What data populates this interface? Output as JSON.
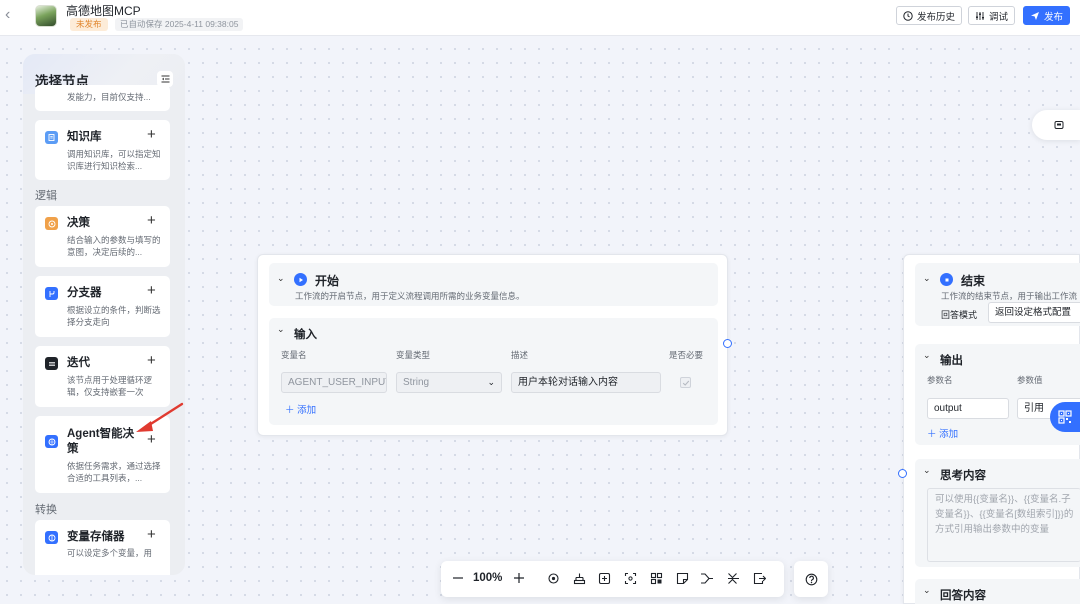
{
  "header": {
    "app_title": "高德地图MCP",
    "status_badge": "未发布",
    "autosave": "已自动保存 2025-4-11 09:38:05",
    "history_label": "发布历史",
    "debug_label": "调试",
    "publish_label": "发布"
  },
  "sidebar": {
    "title": "选择节点",
    "top_card_partial": "发能力，目前仅支持...",
    "cards": [
      {
        "name": "知识库",
        "desc": "调用知识库，可以指定知识库进行知识检索...",
        "icon": "knowledge-icon",
        "color": "#5b9cf5"
      },
      {
        "name": "决策",
        "desc": "结合输入的参数与填写的意图，决定后续的...",
        "icon": "decision-icon",
        "color": "#f0a14a"
      },
      {
        "name": "分支器",
        "desc": "根据设立的条件，判断选择分支走向",
        "icon": "branch-icon",
        "color": "#3370ff"
      },
      {
        "name": "迭代",
        "desc": "该节点用于处理循环逻辑，仅支持嵌套一次",
        "icon": "iteration-icon",
        "color": "#1f2329"
      },
      {
        "name": "Agent智能决策",
        "desc": "依据任务需求，通过选择合适的工具列表，...",
        "icon": "agent-icon",
        "color": "#3370ff"
      },
      {
        "name": "变量存储器",
        "desc": "可以设定多个变量，用",
        "icon": "variable-icon",
        "color": "#3370ff"
      }
    ],
    "groups": {
      "logic": "逻辑",
      "convert": "转换"
    }
  },
  "start_node": {
    "title": "开始",
    "desc": "工作流的开启节点，用于定义流程调用所需的业务变量信息。",
    "section_title": "输入",
    "columns": [
      "变量名",
      "变量类型",
      "描述",
      "是否必要"
    ],
    "row": {
      "var_name": "AGENT_USER_INPUT",
      "var_type": "String",
      "description": "用户本轮对话输入内容"
    },
    "add_label": "添加"
  },
  "end_node": {
    "title": "结束",
    "desc": "工作流的结束节点，用于输出工作流",
    "mode_label": "回答模式",
    "mode_value": "返回设定格式配置",
    "output_title": "输出",
    "param_name_col": "参数名",
    "param_value_col": "参数值",
    "param_name": "output",
    "param_ref": "引用",
    "add_label": "添加",
    "think_title": "思考内容",
    "think_placeholder": "可以使用{{变量名}}、{{变量名.子变量名}}、{{变量名[数组索引]}}的方式引用输出参数中的变量",
    "answer_title": "回答内容"
  },
  "toolbar": {
    "zoom": "100%"
  }
}
